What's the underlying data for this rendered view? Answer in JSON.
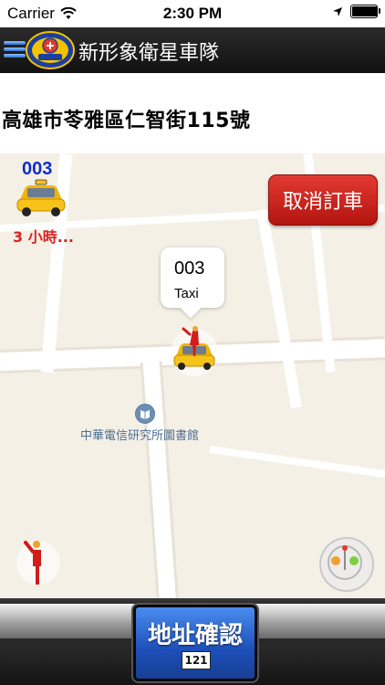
{
  "status_bar": {
    "carrier": "Carrier",
    "time": "2:30 PM",
    "battery_level": 1.0
  },
  "nav": {
    "title": "新形象衛星車隊",
    "menu_icon": "hamburger-menu-icon",
    "logo": "fleet-logo"
  },
  "address": {
    "text": "高雄市苓雅區仁智街115號"
  },
  "map": {
    "poi_label": "中華電信研究所圖書館",
    "callout": {
      "title": "003",
      "subtitle": "Taxi"
    },
    "cancel_button": "取消訂車",
    "driver": {
      "number": "003",
      "eta": "3 小時...",
      "icon": "taxi-icon"
    },
    "person_icon": "hailing-person-icon",
    "locate_icon": "locate-me-icon"
  },
  "bottom": {
    "confirm_label": "地址確認",
    "confirm_badge": "121"
  },
  "colors": {
    "cancel_red": "#c8201a",
    "confirm_blue": "#2a62d0",
    "driver_blue": "#1030c8",
    "eta_red": "#e02020",
    "map_bg": "#f5f0e6"
  }
}
